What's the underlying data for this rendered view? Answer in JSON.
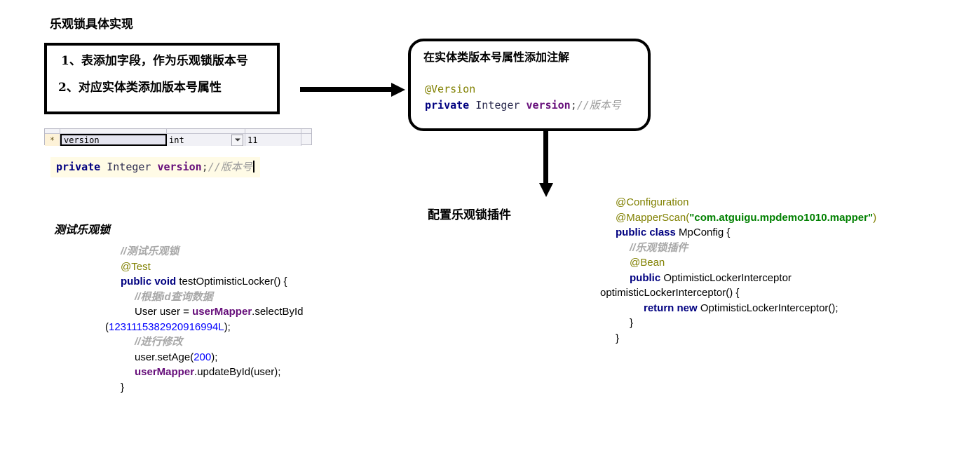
{
  "page": {
    "heading": "乐观锁具体实现",
    "test_heading": "测试乐观锁",
    "plugin_heading": "配置乐观锁插件"
  },
  "steps_box": {
    "line1": "1、表添加字段，作为乐观锁版本号",
    "line2": "2、对应实体类添加版本号属性"
  },
  "annotation_box": {
    "title": "在实体类版本号属性添加注解",
    "code": {
      "annotation": "@Version",
      "modifier": "private",
      "type": "Integer",
      "name": "version",
      "semicolon": ";",
      "comment": "//版本号"
    }
  },
  "field_grid": {
    "marker": "*",
    "name": "version",
    "type": "int",
    "length": "11",
    "dropdown_icon": "chevron-down-icon"
  },
  "editor_line": {
    "modifier": "private",
    "type": "Integer",
    "name": "version",
    "semicolon": ";",
    "comment": "//版本号"
  },
  "test_code": {
    "lines": [
      {
        "indent": 0,
        "parts": [
          {
            "t": "//测试乐观锁",
            "c": "c"
          }
        ]
      },
      {
        "indent": 0,
        "parts": [
          {
            "t": "@Test",
            "c": "a"
          }
        ]
      },
      {
        "indent": 0,
        "parts": [
          {
            "t": "public void",
            "c": "k"
          },
          {
            "t": " testOptimisticLocker() {",
            "c": "p"
          }
        ]
      },
      {
        "indent": 1,
        "parts": [
          {
            "t": "//根据id查询数据",
            "c": "c"
          }
        ]
      },
      {
        "indent": 1,
        "parts": [
          {
            "t": "User user = ",
            "c": "p"
          },
          {
            "t": "userMapper",
            "c": "f"
          },
          {
            "t": ".selectById",
            "c": "p"
          }
        ]
      },
      {
        "indent": -1,
        "parts": [
          {
            "t": "(",
            "c": "p"
          },
          {
            "t": "1231115382920916994L",
            "c": "n"
          },
          {
            "t": ");",
            "c": "p"
          }
        ]
      },
      {
        "indent": 1,
        "parts": [
          {
            "t": "//进行修改",
            "c": "c"
          }
        ]
      },
      {
        "indent": 1,
        "parts": [
          {
            "t": "user.setAge(",
            "c": "p"
          },
          {
            "t": "200",
            "c": "n"
          },
          {
            "t": ");",
            "c": "p"
          }
        ]
      },
      {
        "indent": 1,
        "parts": [
          {
            "t": "userMapper",
            "c": "f"
          },
          {
            "t": ".updateById(user);",
            "c": "p"
          }
        ]
      },
      {
        "indent": 0,
        "parts": [
          {
            "t": "}",
            "c": "p"
          }
        ]
      }
    ]
  },
  "config_code": {
    "lines": [
      {
        "indent": 0,
        "parts": [
          {
            "t": "@Configuration",
            "c": "a"
          }
        ]
      },
      {
        "indent": 0,
        "parts": [
          {
            "t": "@MapperScan(",
            "c": "a"
          },
          {
            "t": "\"com.atguigu.mpdemo1010.mapper\"",
            "c": "s"
          },
          {
            "t": ")",
            "c": "a"
          }
        ]
      },
      {
        "indent": 0,
        "parts": [
          {
            "t": "public class",
            "c": "k"
          },
          {
            "t": " MpConfig {",
            "c": "p"
          }
        ]
      },
      {
        "indent": 0,
        "parts": [
          {
            "t": " ",
            "c": "p"
          }
        ]
      },
      {
        "indent": 1,
        "parts": [
          {
            "t": "//乐观锁插件",
            "c": "c"
          }
        ]
      },
      {
        "indent": 1,
        "parts": [
          {
            "t": "@Bean",
            "c": "a"
          }
        ]
      },
      {
        "indent": 1,
        "parts": [
          {
            "t": "public",
            "c": "k"
          },
          {
            "t": " OptimisticLockerInterceptor",
            "c": "p"
          }
        ]
      },
      {
        "indent": -1,
        "parts": [
          {
            "t": "optimisticLockerInterceptor() {",
            "c": "p"
          }
        ]
      },
      {
        "indent": 2,
        "parts": [
          {
            "t": "return new",
            "c": "k"
          },
          {
            "t": " OptimisticLockerInterceptor();",
            "c": "p"
          }
        ]
      },
      {
        "indent": 1,
        "parts": [
          {
            "t": "}",
            "c": "p"
          }
        ]
      },
      {
        "indent": 0,
        "parts": [
          {
            "t": "}",
            "c": "p"
          }
        ]
      }
    ]
  },
  "arrows": {
    "horizontal": "arrow-right",
    "vertical": "arrow-down"
  },
  "colors": {
    "keyword": "#000080",
    "annotation": "#808000",
    "string": "#008000",
    "field": "#660e7a",
    "comment": "#a8a8a8",
    "number": "#0000ff"
  }
}
